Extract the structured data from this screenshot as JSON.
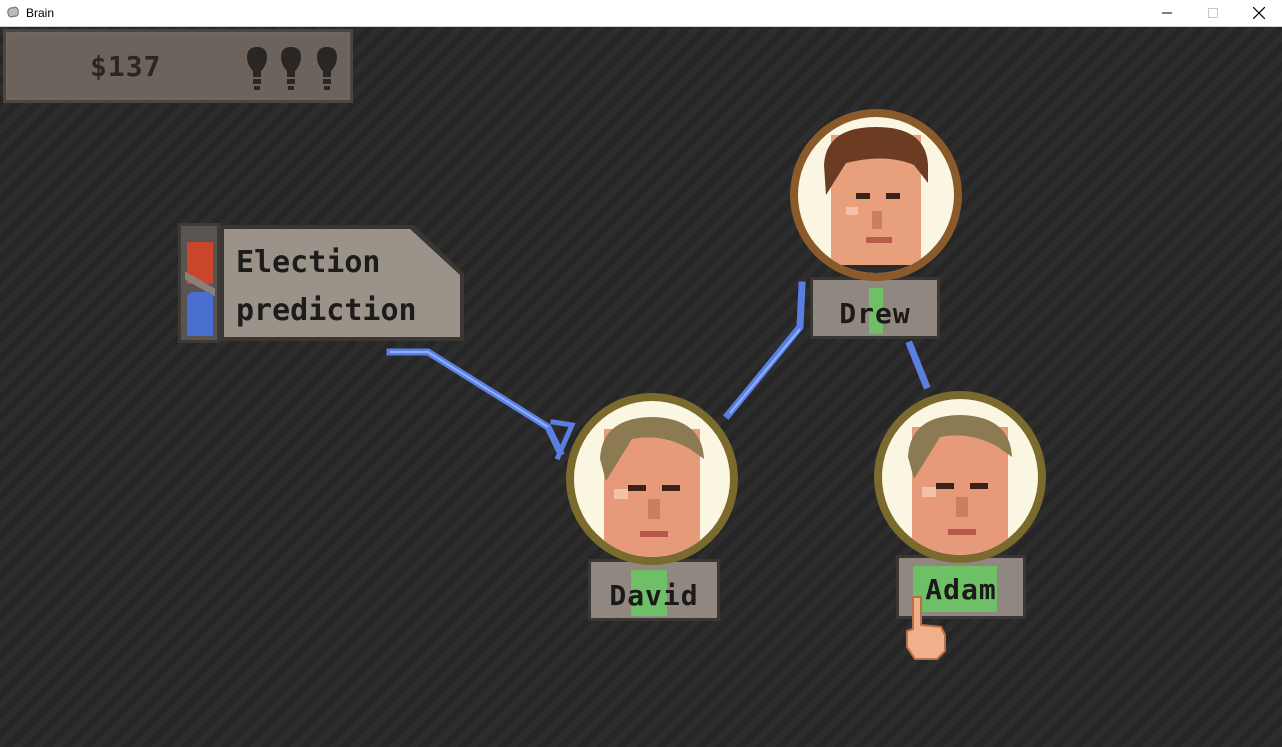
{
  "window": {
    "title": "Brain",
    "icon": "brain-app-icon",
    "controls": [
      "minimize-icon",
      "maximize-icon",
      "close-icon"
    ]
  },
  "hud": {
    "money": "$137",
    "bulbs": [
      "bulb-icon",
      "bulb-icon",
      "bulb-icon"
    ]
  },
  "election": {
    "label_line1": "Election",
    "label_line2": "prediction",
    "colors": {
      "red": "#c9462c",
      "blue": "#4b6fd0"
    }
  },
  "people": {
    "drew": {
      "name": "Drew",
      "ring_color": "#8b5a2b"
    },
    "david": {
      "name": "David",
      "ring_color": "#7a6a2e"
    },
    "adam": {
      "name": "Adam",
      "ring_color": "#7a6a2e"
    }
  },
  "colors": {
    "connection": "#5a7fe0",
    "name_progress": "#6fbf66",
    "panel": "#8f8780"
  }
}
